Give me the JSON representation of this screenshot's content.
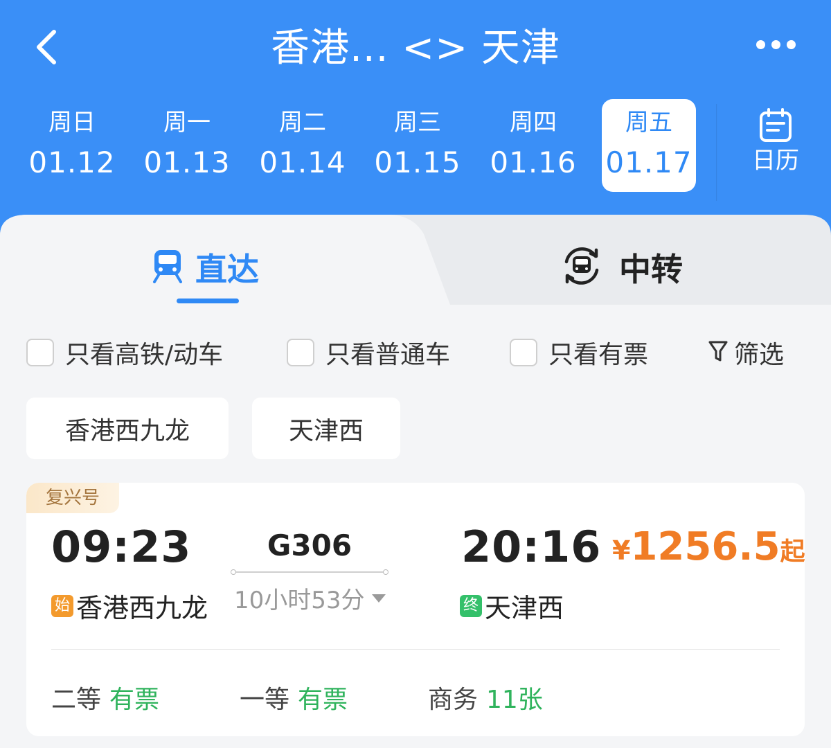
{
  "header": {
    "title": "香港... <> 天津",
    "dates": [
      {
        "dow": "周日",
        "md": "01.12"
      },
      {
        "dow": "周一",
        "md": "01.13"
      },
      {
        "dow": "周二",
        "md": "01.14"
      },
      {
        "dow": "周三",
        "md": "01.15"
      },
      {
        "dow": "周四",
        "md": "01.16"
      },
      {
        "dow": "周五",
        "md": "01.17"
      }
    ],
    "selected_date_index": 5,
    "calendar_label": "日历"
  },
  "tabs": {
    "direct": "直达",
    "transfer": "中转",
    "active": "direct"
  },
  "filters": {
    "high_speed_only": "只看高铁/动车",
    "normal_only": "只看普通车",
    "available_only": "只看有票",
    "filter_button": "筛选"
  },
  "station_chips": {
    "origin": "香港西九龙",
    "destination": "天津西"
  },
  "train": {
    "badge": "复兴号",
    "dep_time": "09:23",
    "dep_tag": "始",
    "dep_station": "香港西九龙",
    "train_no": "G306",
    "duration": "10小时53分",
    "arr_time": "20:16",
    "arr_tag": "终",
    "arr_station": "天津西",
    "price_currency": "¥",
    "price_amount": "1256.5",
    "price_suffix": "起",
    "seats": [
      {
        "class": "二等",
        "availability": "有票"
      },
      {
        "class": "一等",
        "availability": "有票"
      },
      {
        "class": "商务",
        "availability": "11张"
      }
    ]
  },
  "colors": {
    "header_blue": "#3a8ff7",
    "accent_blue": "#2f89f5",
    "price_orange": "#f07c25",
    "available_green": "#2fb35c",
    "start_tag": "#f39a2d",
    "end_tag": "#34c06a"
  },
  "icons": [
    "back-arrow-icon",
    "more-dots-icon",
    "calendar-icon",
    "train-icon",
    "transfer-icon",
    "filter-funnel-icon"
  ]
}
